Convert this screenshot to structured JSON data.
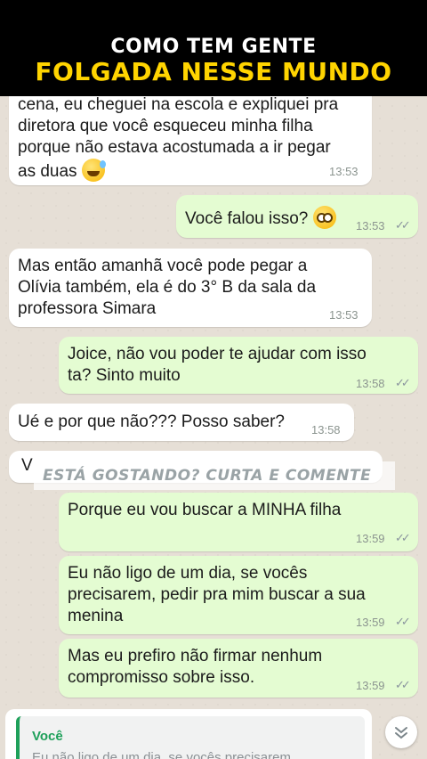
{
  "header": {
    "line1": "COMO TEM GENTE",
    "line2": "FOLGADA NESSE MUNDO"
  },
  "messages": [
    {
      "text": "cena, eu cheguei na escola e expliquei pra\ndiretora que você esqueceu minha filha\nporque não estava acostumada a ir pegar\nas duas",
      "time": "13:53",
      "emoji": "sweat-smile-emoji"
    },
    {
      "text": "Você falou isso?",
      "time": "13:53",
      "emoji": "flushed-emoji"
    },
    {
      "text": "Mas então amanhã você pode pegar a\nOlívia também, ela é do 3° B da sala da\nprofessora Simara",
      "time": "13:53"
    },
    {
      "text": "Joice, não vou poder te ajudar com isso\nta? Sinto muito",
      "time": "13:58"
    },
    {
      "text": "Ué e por que não??? Posso saber?",
      "time": "13:58"
    },
    {
      "text": "V",
      "time": ""
    },
    {
      "text": "Porque eu vou buscar a MINHA filha",
      "time": "13:59"
    },
    {
      "text": "Eu não ligo de um dia, se vocês\nprecisarem, pedir pra mim buscar a sua\nmenina",
      "time": "13:59"
    },
    {
      "text": "Mas eu prefiro não firmar nenhum\ncompromisso sobre isso.",
      "time": "13:59"
    }
  ],
  "overlay": {
    "text": "ESTÁ GOSTANDO? CURTA E COMENTE"
  },
  "reply_preview": {
    "author": "Você",
    "snippet": "Eu não ligo de um dia, se vocês precisarem"
  },
  "icons": {
    "read_ticks": "double-check-icon",
    "scroll": "chevron-double-down-icon"
  },
  "colors": {
    "incoming_bubble": "#ffffff",
    "outgoing_bubble": "#e4fcd2",
    "header_title": "#ffd400",
    "reply_accent": "#1ea05a"
  }
}
